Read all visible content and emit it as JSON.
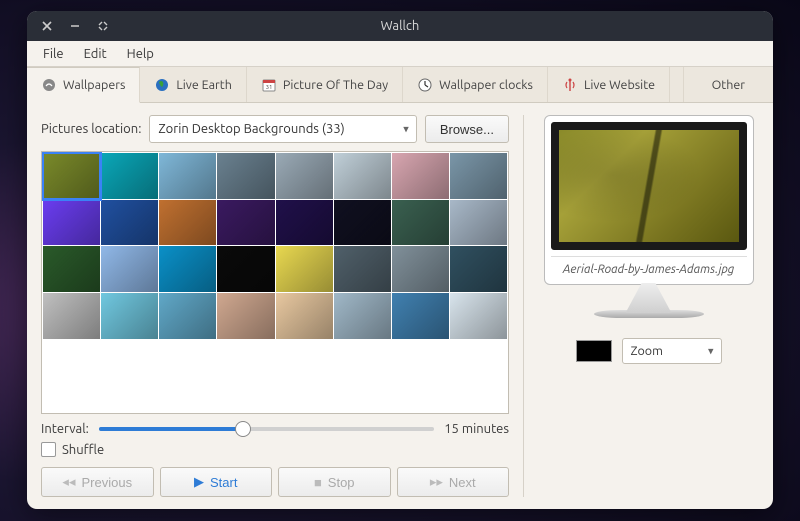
{
  "window": {
    "title": "Wallch"
  },
  "menubar": {
    "file": "File",
    "edit": "Edit",
    "help": "Help"
  },
  "tabs": {
    "wallpapers": "Wallpapers",
    "live_earth": "Live Earth",
    "potd": "Picture Of The Day",
    "clocks": "Wallpaper clocks",
    "live_website": "Live Website",
    "other": "Other",
    "active": "wallpapers"
  },
  "location": {
    "label": "Pictures location:",
    "selected": "Zorin Desktop Backgrounds (33)",
    "browse": "Browse..."
  },
  "thumbnails": {
    "count_visible": 32,
    "selected_index": 0,
    "palette": [
      "#7a8a2a",
      "#0aa7b8",
      "#7fb7d8",
      "#6a8190",
      "#9aaab6",
      "#c0cfd8",
      "#d8a6b0",
      "#7a96a8",
      "#6a3df0",
      "#2050a0",
      "#c07030",
      "#3a1a60",
      "#20104a",
      "#101020",
      "#3a6050",
      "#a8b8c8",
      "#2a5a2a",
      "#90b8e8",
      "#0a90c8",
      "#0a0a0a",
      "#e8d850",
      "#50606a",
      "#80909a",
      "#305060",
      "#c0c0c0",
      "#70c8e0",
      "#60a8c8",
      "#d0a890",
      "#e8c8a0",
      "#a0b8c8",
      "#4080b0",
      "#d8e4ec"
    ]
  },
  "interval": {
    "label": "Interval:",
    "text": "15 minutes",
    "percent": 43
  },
  "shuffle": {
    "label": "Shuffle",
    "checked": false
  },
  "controls": {
    "previous": "Previous",
    "start": "Start",
    "stop": "Stop",
    "next": "Next"
  },
  "preview": {
    "filename": "Aerial-Road-by-James-Adams.jpg",
    "bg_color": "#000000",
    "scale_mode": "Zoom"
  }
}
